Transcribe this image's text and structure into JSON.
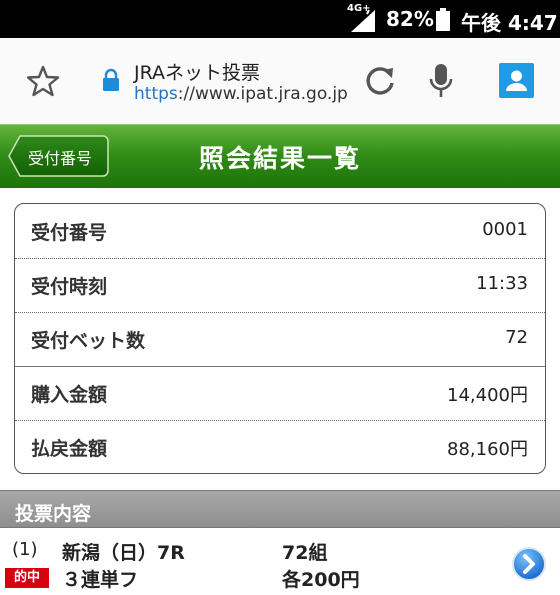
{
  "status_bar": {
    "network": "4G+",
    "battery_percent": "82%",
    "time": "午後 4:47"
  },
  "browser": {
    "site_title": "JRAネット投票",
    "url_scheme": "https",
    "url_rest": "://www.ipat.jra.go.jp",
    "icons": [
      "star-icon",
      "lock-icon",
      "reload-icon",
      "mic-icon",
      "account-icon"
    ]
  },
  "header": {
    "back_label": "受付番号",
    "title": "照会結果一覧"
  },
  "receipt": {
    "rows": [
      {
        "label": "受付番号",
        "value": "0001"
      },
      {
        "label": "受付時刻",
        "value": "11:33"
      },
      {
        "label": "受付ベット数",
        "value": "72"
      },
      {
        "label": "購入金額",
        "value": "14,400円"
      },
      {
        "label": "払戻金額",
        "value": "88,160円"
      }
    ]
  },
  "section": {
    "title": "投票内容"
  },
  "bets": [
    {
      "number": "(1)",
      "race": "新潟（日）7R",
      "combinations": "72組",
      "badge": "的中",
      "type": "３連単フ",
      "amount": "各200円"
    }
  ],
  "colors": {
    "header_green": "#2f8a16",
    "badge_red": "#d7000f",
    "account_blue": "#1e9be6",
    "link_blue": "#1f74c8"
  }
}
